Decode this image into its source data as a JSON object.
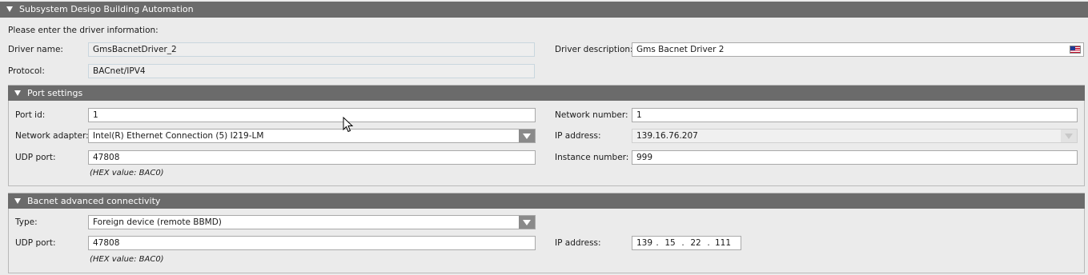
{
  "subsystem": {
    "title": "Subsystem Desigo Building Automation",
    "intro": "Please enter the driver information:",
    "driver_name_label": "Driver name:",
    "driver_name_value": "GmsBacnetDriver_2",
    "protocol_label": "Protocol:",
    "protocol_value": "BACnet/IPV4",
    "driver_description_label": "Driver description:",
    "driver_description_value": "Gms Bacnet Driver 2",
    "flag_icon": "us-flag-icon"
  },
  "port_settings": {
    "title": "Port settings",
    "port_id_label": "Port id:",
    "port_id_value": "1",
    "network_adapter_label": "Network adapter:",
    "network_adapter_value": "Intel(R) Ethernet Connection (5) I219-LM",
    "udp_port_label": "UDP port:",
    "udp_port_value": "47808",
    "udp_hex_hint": "(HEX value: BAC0)",
    "network_number_label": "Network number:",
    "network_number_value": "1",
    "ip_address_label": "IP address:",
    "ip_address_value": "139.16.76.207",
    "instance_number_label": "Instance number:",
    "instance_number_value": "999"
  },
  "advanced": {
    "title": "Bacnet advanced connectivity",
    "type_label": "Type:",
    "type_value": "Foreign device (remote BBMD)",
    "udp_port_label": "UDP port:",
    "udp_port_value": "47808",
    "udp_hex_hint": "(HEX value: BAC0)",
    "ip_address_label": "IP address:",
    "ip_octets": [
      "139",
      "15",
      "22",
      "111"
    ]
  }
}
